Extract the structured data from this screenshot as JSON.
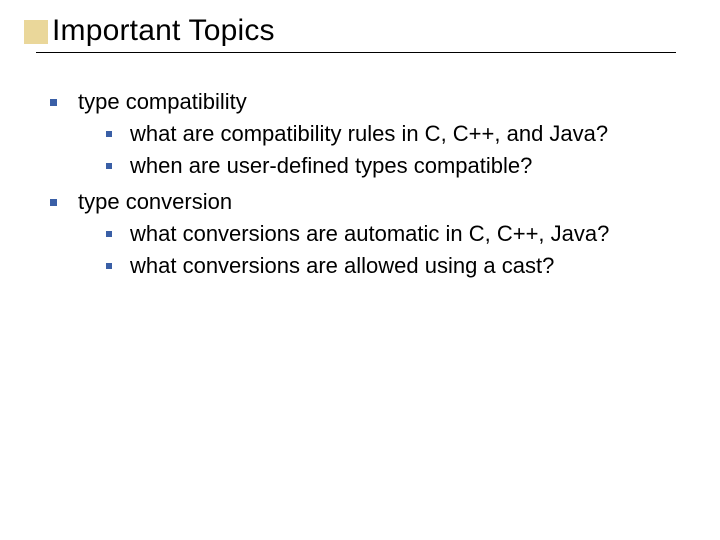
{
  "title": "Important Topics",
  "items": [
    {
      "label": "type compatibility",
      "children": [
        {
          "label": "what are compatibility rules in C, C++, and Java?"
        },
        {
          "label": "when are user-defined types compatible?"
        }
      ]
    },
    {
      "label": "type conversion",
      "children": [
        {
          "label": "what conversions are automatic in C, C++, Java?"
        },
        {
          "label": "what conversions are allowed using a cast?"
        }
      ]
    }
  ]
}
